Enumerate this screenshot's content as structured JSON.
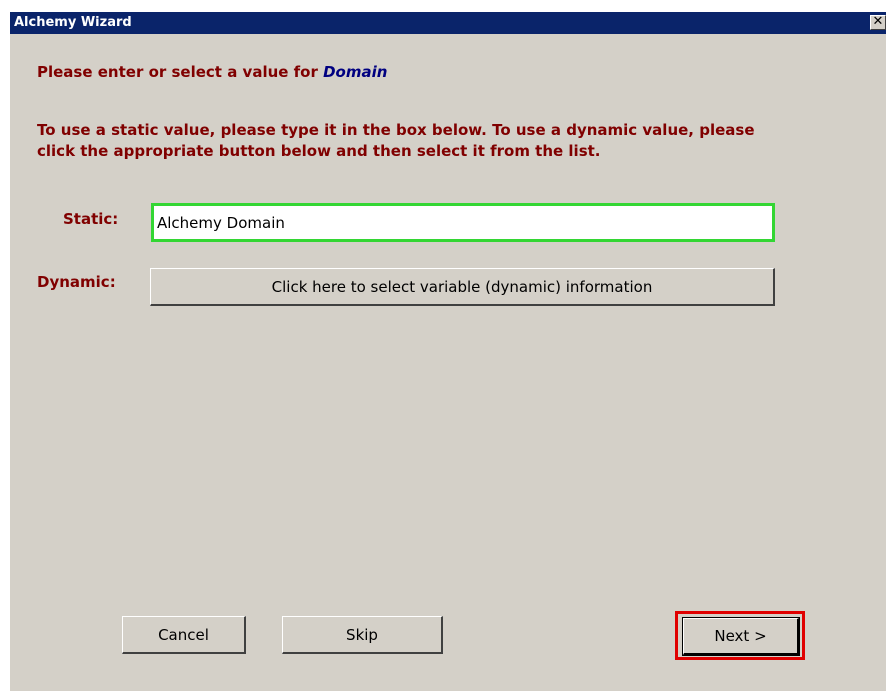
{
  "window": {
    "title": "Alchemy Wizard",
    "close_glyph": "✕"
  },
  "prompt": {
    "text": "Please enter or select a value for ",
    "field_name": "Domain"
  },
  "instructions": "To use a static value, please type it in the box below.  To use a dynamic value, please click the appropriate button below and then select it from the list.",
  "static": {
    "label": "Static:",
    "value": "Alchemy Domain"
  },
  "dynamic": {
    "label": "Dynamic:",
    "button_label": "Click here to select variable (dynamic) information"
  },
  "buttons": {
    "cancel": "Cancel",
    "skip": "Skip",
    "next": "Next >"
  },
  "colors": {
    "title_bar": "#0a246a",
    "window_bg": "#d4d0c8",
    "label_text": "#800000",
    "field_name_text": "#000080",
    "input_focus_border": "#33d633",
    "next_highlight": "#e00000"
  },
  "icons": {
    "close": "close-icon"
  }
}
